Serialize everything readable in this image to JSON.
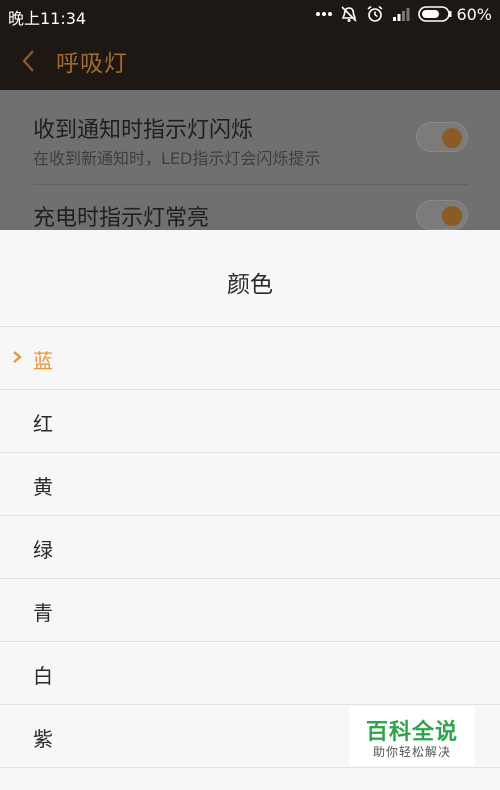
{
  "status_bar": {
    "time": "晚上11:34",
    "battery_percent": "60%",
    "icons": [
      "more-dots-icon",
      "alarm-off-icon",
      "alarm-clock-icon",
      "signal-icon",
      "battery-icon"
    ]
  },
  "header": {
    "back_icon": "chevron-left-icon",
    "title": "呼吸灯"
  },
  "settings": {
    "items": [
      {
        "title": "收到通知时指示灯闪烁",
        "subtitle": "在收到新通知时，LED指示灯会闪烁提示",
        "enabled": true
      },
      {
        "title": "充电时指示灯常亮",
        "enabled": true
      }
    ]
  },
  "color_sheet": {
    "title": "颜色",
    "selected_index": 0,
    "options": [
      "蓝",
      "红",
      "黄",
      "绿",
      "青",
      "白",
      "紫"
    ]
  },
  "watermark": {
    "main": "百科全说",
    "sub": "助你轻松解决"
  },
  "colors": {
    "accent": "#e8953a",
    "title_dim": "#a26b2c",
    "watermark_green": "#2fa34a"
  }
}
